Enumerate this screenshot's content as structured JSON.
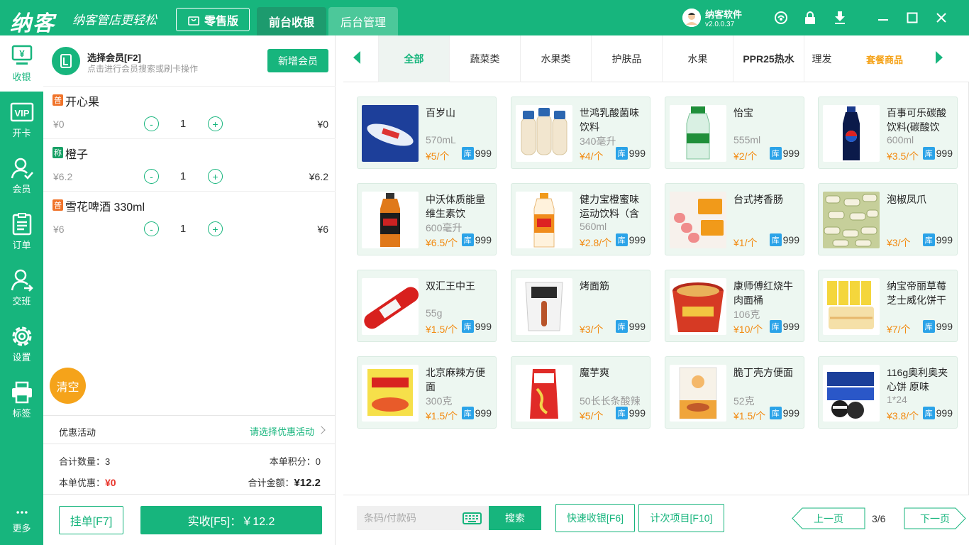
{
  "header": {
    "logo": "纳客",
    "slogan": "纳客管店更轻松",
    "edition": "零售版",
    "tabs": [
      {
        "label": "前台收银",
        "active": true
      },
      {
        "label": "后台管理",
        "active": false
      }
    ],
    "user": {
      "name": "纳客软件",
      "version": "v2.0.0.37"
    },
    "icons": [
      "support-icon",
      "lock-icon",
      "download-icon",
      "minimize-icon",
      "maximize-icon",
      "close-icon"
    ]
  },
  "sidebar": {
    "items": [
      {
        "label": "收银",
        "icon": "cashier-icon",
        "active": true
      },
      {
        "label": "开卡",
        "icon": "vip-card-icon"
      },
      {
        "label": "会员",
        "icon": "member-icon"
      },
      {
        "label": "订单",
        "icon": "order-icon"
      },
      {
        "label": "交班",
        "icon": "handover-icon"
      },
      {
        "label": "设置",
        "icon": "gear-icon"
      },
      {
        "label": "标签",
        "icon": "printer-icon"
      },
      {
        "label": "更多",
        "icon": "more-icon"
      }
    ]
  },
  "member": {
    "title": "选择会员[F2]",
    "subtitle": "点击进行会员搜索或刷卡操作",
    "add_button": "新增会员"
  },
  "cart": {
    "items": [
      {
        "tag": "普",
        "tag_type": "pu",
        "name": "开心果",
        "price": "¥0",
        "qty": "1",
        "subtotal": "¥0"
      },
      {
        "tag": "称",
        "tag_type": "cheng",
        "name": "橙子",
        "price": "¥6.2",
        "qty": "1",
        "subtotal": "¥6.2"
      },
      {
        "tag": "普",
        "tag_type": "pu",
        "name": "雪花啤酒 330ml",
        "price": "¥6",
        "qty": "1",
        "subtotal": "¥6"
      }
    ],
    "minus": "-",
    "plus": "+",
    "clear_button": "清空"
  },
  "promotion": {
    "label": "优惠活动",
    "action": "请选择优惠活动"
  },
  "summary": {
    "count_label": "合计数量：",
    "count": "3",
    "points_label": "本单积分：",
    "points": "0",
    "discount_label": "本单优惠：",
    "discount": "¥0",
    "total_label": "合计金额：",
    "total": "¥12.2"
  },
  "actions": {
    "hold_button": "挂单[F7]",
    "pay_button": "实收[F5]：￥12.2"
  },
  "categories": {
    "tabs": [
      "全部",
      "蔬菜类",
      "水果类",
      "护肤品",
      "水果",
      "PPR25热水",
      "理发"
    ],
    "combo": "套餐商品",
    "active_index": 0
  },
  "products": [
    {
      "name": "百岁山",
      "spec": "570mL",
      "price": "¥5/个",
      "stock": "999",
      "img": "water-bottle"
    },
    {
      "name": "世鸿乳酸菌味饮料",
      "spec": "340毫升",
      "price": "¥4/个",
      "stock": "999",
      "img": "yogurt-bottles"
    },
    {
      "name": "怡宝",
      "spec": "555ml",
      "price": "¥2/个",
      "stock": "999",
      "img": "green-water"
    },
    {
      "name": "百事可乐碳酸饮料(碳酸饮",
      "spec": "600ml",
      "price": "¥3.5/个",
      "stock": "999",
      "img": "pepsi"
    },
    {
      "name": "中沃体质能量维生素饮",
      "spec": "600毫升",
      "price": "¥6.5/个",
      "stock": "999",
      "img": "energy-drink"
    },
    {
      "name": "健力宝橙蜜味运动饮料（含",
      "spec": "560ml",
      "price": "¥2.8/个",
      "stock": "999",
      "img": "orange-drink"
    },
    {
      "name": "台式拷香肠",
      "spec": "",
      "price": "¥1/个",
      "stock": "999",
      "img": "sausage"
    },
    {
      "name": "泡椒凤爪",
      "spec": "",
      "price": "¥3/个",
      "stock": "999",
      "img": "chicken-feet"
    },
    {
      "name": "双汇王中王",
      "spec": "55g",
      "price": "¥1.5/个",
      "stock": "999",
      "img": "ham-sausage"
    },
    {
      "name": "烤面筋",
      "spec": "",
      "price": "¥3/个",
      "stock": "999",
      "img": "gluten-pack"
    },
    {
      "name": "康师傅红烧牛肉面桶",
      "spec": "106克",
      "price": "¥10/个",
      "stock": "999",
      "img": "noodle-bucket"
    },
    {
      "name": "纳宝帝丽草莓芝士威化饼干",
      "spec": "",
      "price": "¥7/个",
      "stock": "999",
      "img": "wafer"
    },
    {
      "name": "北京麻辣方便面",
      "spec": "300克",
      "price": "¥1.5/个",
      "stock": "999",
      "img": "spicy-noodle"
    },
    {
      "name": "魔芋爽",
      "spec": "50长长条酸辣",
      "price": "¥5/个",
      "stock": "999",
      "img": "konjac"
    },
    {
      "name": "脆丁壳方便面",
      "spec": "52克",
      "price": "¥1.5/个",
      "stock": "999",
      "img": "crispy-noodle"
    },
    {
      "name": "116g奥利奥夹心饼 原味",
      "spec": "1*24",
      "price": "¥3.8/个",
      "stock": "999",
      "img": "oreo"
    }
  ],
  "stock_tag": "库",
  "bottom": {
    "barcode_placeholder": "条码/付款码",
    "search_button": "搜索",
    "quick_button": "快速收银[F6]",
    "count_button": "计次项目[F10]",
    "prev_button": "上一页",
    "page": "3/6",
    "next_button": "下一页"
  },
  "colors": {
    "primary": "#17b57d",
    "price": "#f28b12",
    "discount": "#e8342b",
    "stock_tag": "#2ba3e8",
    "clear": "#f5a31a"
  }
}
